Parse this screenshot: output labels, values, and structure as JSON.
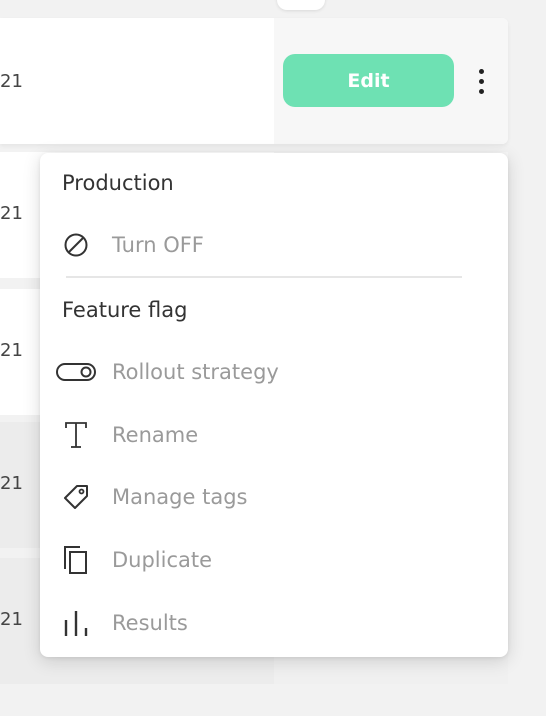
{
  "table": {
    "rows": [
      {
        "date_fragment": "21"
      },
      {
        "date_fragment": "21"
      },
      {
        "date_fragment": "21"
      },
      {
        "date_fragment": "21"
      },
      {
        "date_fragment": "21"
      }
    ],
    "edit_label": "Edit"
  },
  "menu": {
    "production": {
      "title": "Production",
      "items": [
        {
          "label": "Turn OFF",
          "icon": "ban-icon"
        }
      ]
    },
    "feature_flag": {
      "title": "Feature flag",
      "items": [
        {
          "label": "Rollout strategy",
          "icon": "toggle-icon"
        },
        {
          "label": "Rename",
          "icon": "text-icon"
        },
        {
          "label": "Manage tags",
          "icon": "tag-icon"
        },
        {
          "label": "Duplicate",
          "icon": "copy-icon"
        },
        {
          "label": "Results",
          "icon": "bar-chart-icon"
        }
      ]
    }
  },
  "colors": {
    "accent": "#6ee1b3",
    "muted_text": "#9a9a9a",
    "heading_text": "#333333"
  }
}
